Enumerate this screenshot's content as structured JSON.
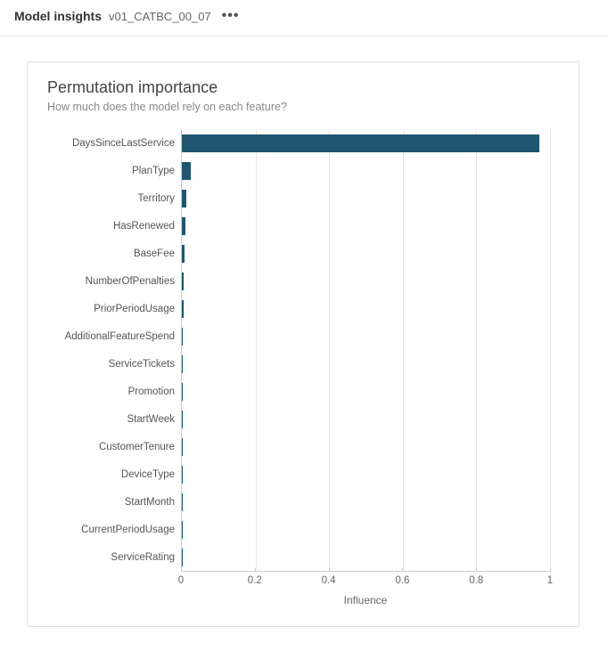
{
  "header": {
    "title": "Model insights",
    "subtitle": "v01_CATBC_00_07",
    "more_icon": "•••"
  },
  "card": {
    "title": "Permutation importance",
    "subtitle": "How much does the model rely on each feature?"
  },
  "chart_data": {
    "type": "bar",
    "orientation": "horizontal",
    "title": "Permutation importance",
    "xlabel": "Influence",
    "ylabel": "",
    "xlim": [
      0,
      1
    ],
    "ticks": [
      0,
      0.2,
      0.4,
      0.6,
      0.8,
      1
    ],
    "categories": [
      "DaysSinceLastService",
      "PlanType",
      "Territory",
      "HasRenewed",
      "BaseFee",
      "NumberOfPenalties",
      "PriorPeriodUsage",
      "AdditionalFeatureSpend",
      "ServiceTickets",
      "Promotion",
      "StartWeek",
      "CustomerTenure",
      "DeviceType",
      "StartMonth",
      "CurrentPeriodUsage",
      "ServiceRating"
    ],
    "values": [
      0.97,
      0.025,
      0.012,
      0.01,
      0.007,
      0.004,
      0.004,
      0.003,
      0.003,
      0.002,
      0.002,
      0.002,
      0.002,
      0.001,
      0.001,
      0.001
    ]
  }
}
